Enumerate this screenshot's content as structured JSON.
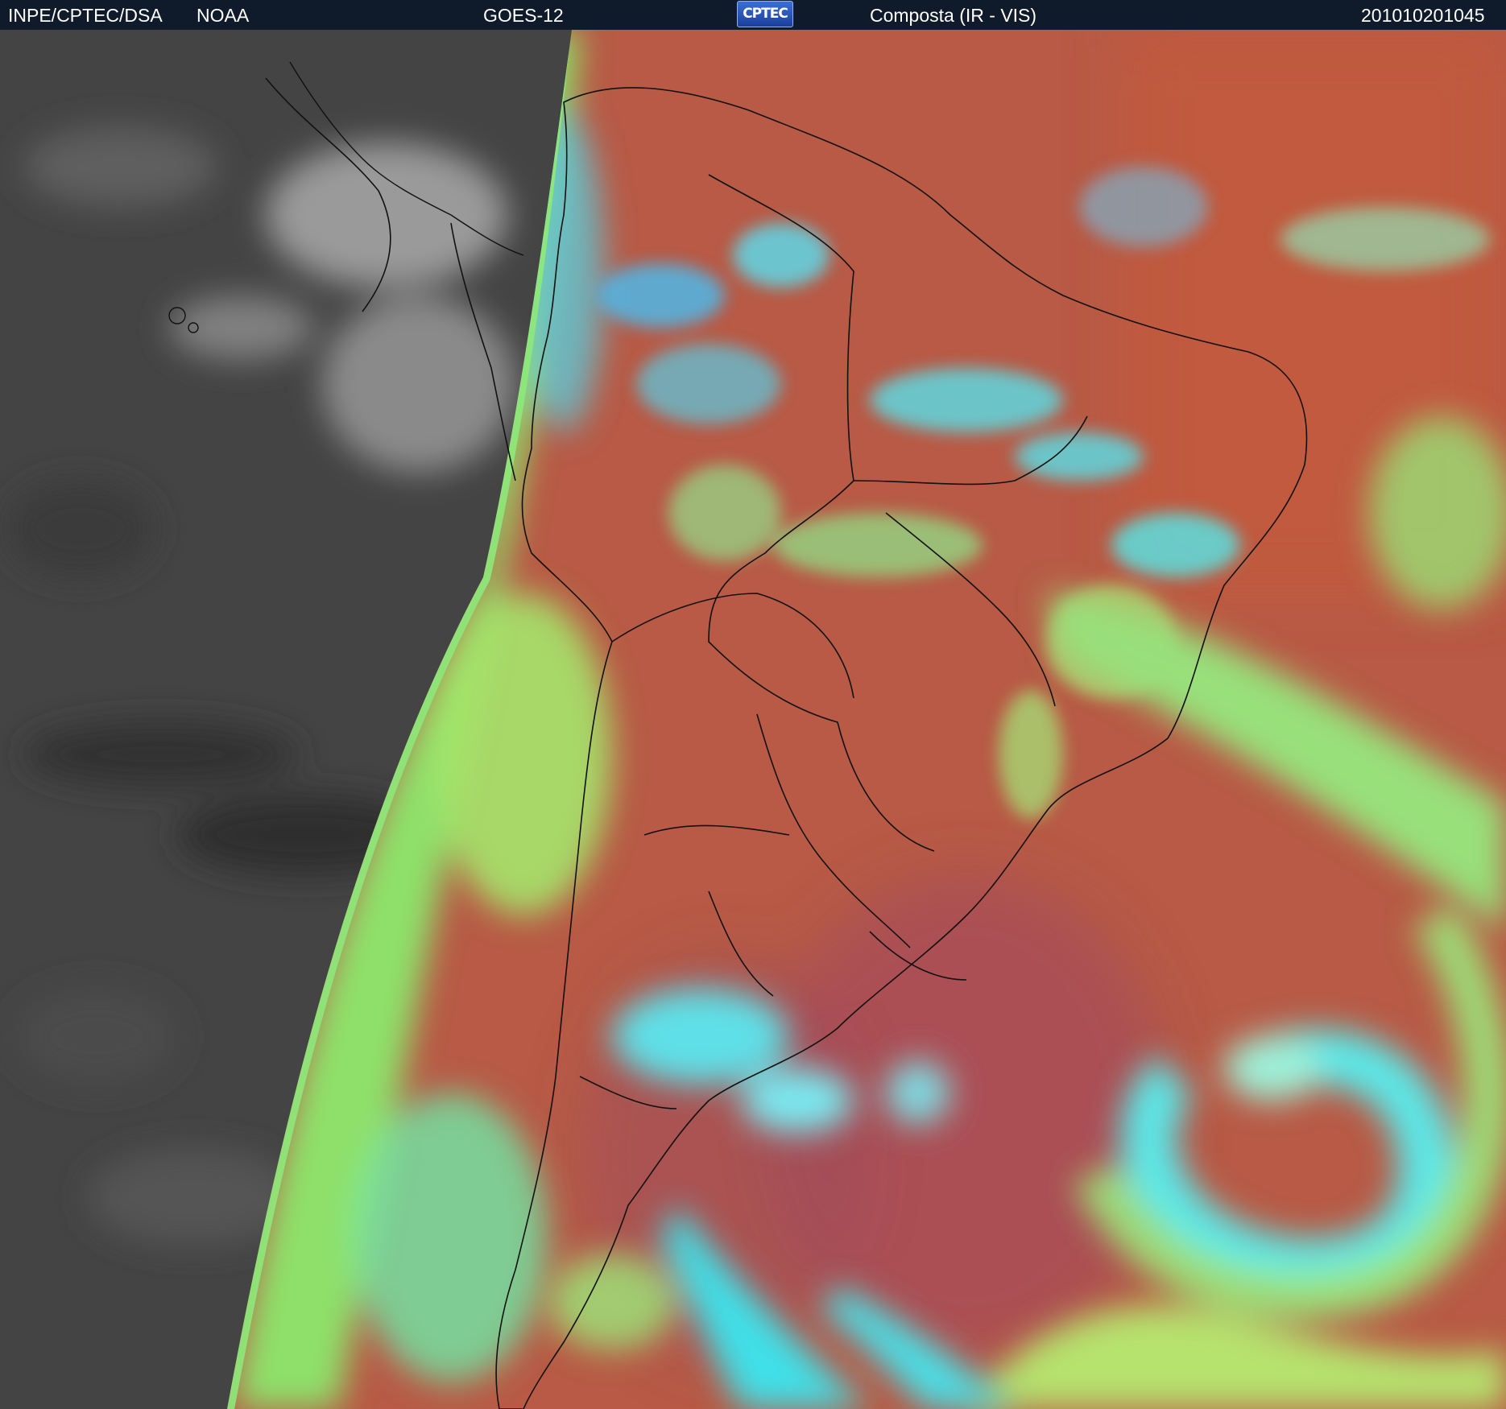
{
  "header": {
    "institution": "INPE/CPTEC/DSA",
    "agency": "NOAA",
    "satellite": "GOES-12",
    "logo_text": "CPTEC",
    "product": "Composta (IR - VIS)",
    "timestamp": "201010201045"
  },
  "colors": {
    "header_bg": "#0f1a2a",
    "night_gray": "#4a4a4a",
    "land_red": "#b85a45",
    "cloud_cyan": "#40e0e8",
    "cloud_green": "#9be86a",
    "border_lines": "#111111"
  }
}
